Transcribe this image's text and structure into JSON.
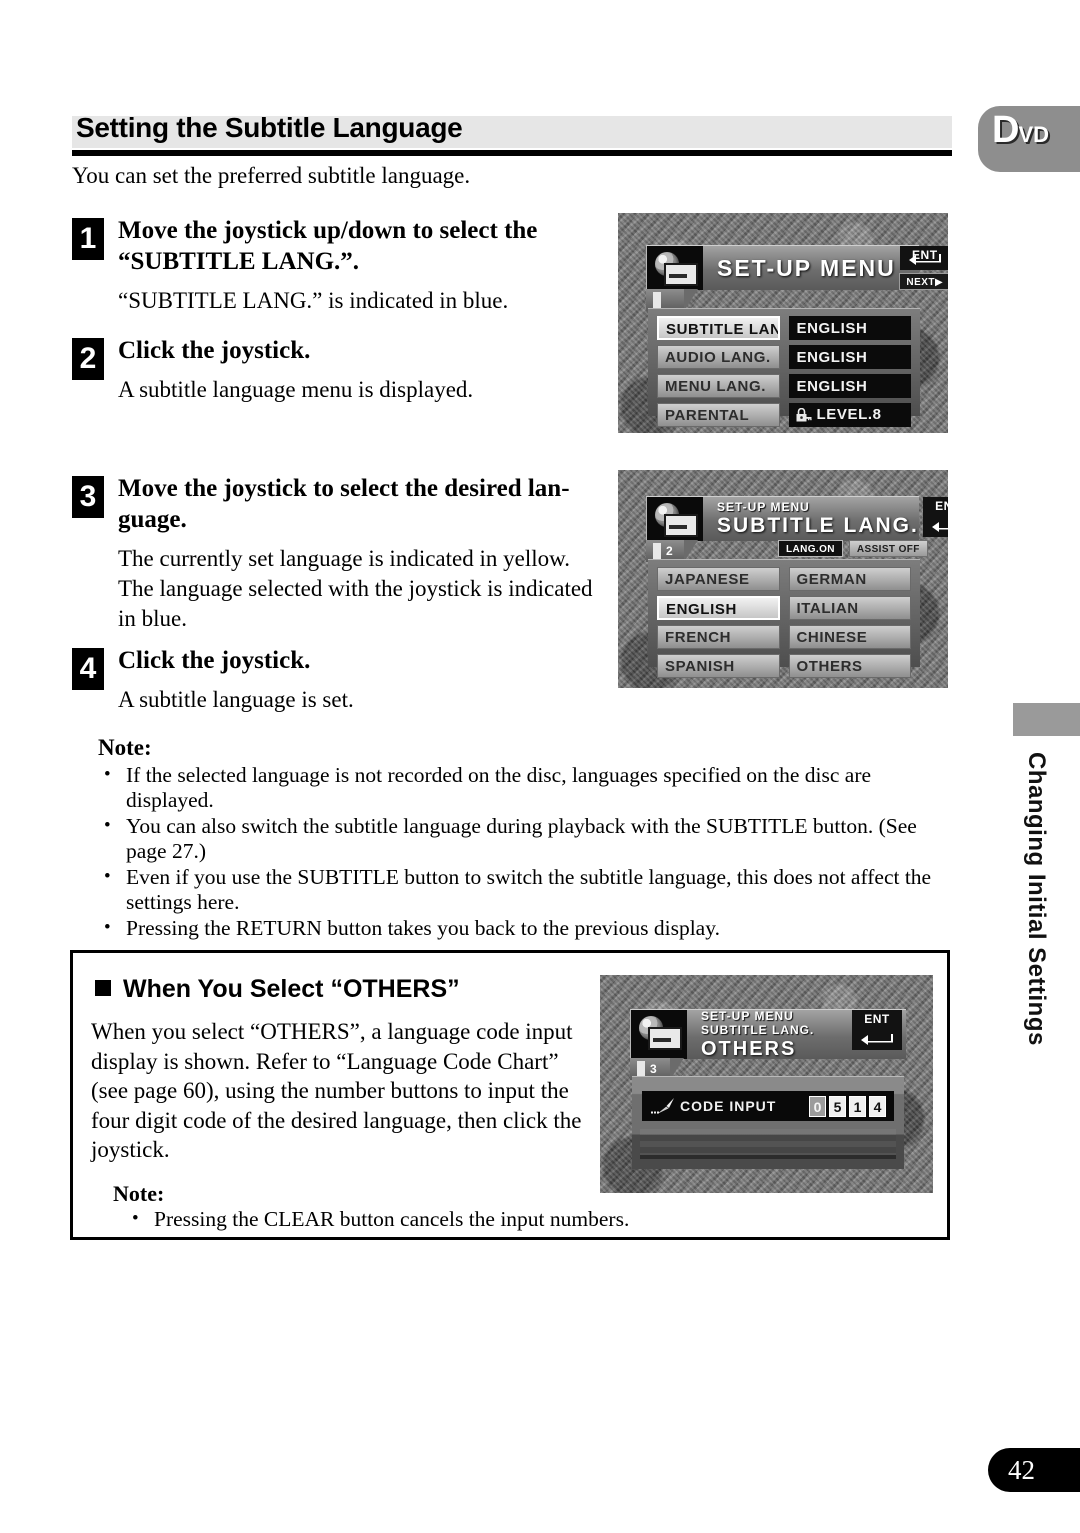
{
  "page": {
    "heading": "Setting the Subtitle Language",
    "intro": "You can set the preferred subtitle language.",
    "badge": {
      "letter": "D",
      "suffix": "VD"
    },
    "side_tab_label": "Changing Initial Settings",
    "page_number": "42"
  },
  "steps": [
    {
      "number": "1",
      "title": "Move the joystick up/down to select the “SUBTITLE LANG.”.",
      "desc": "“SUBTITLE LANG.” is indicated in blue."
    },
    {
      "number": "2",
      "title": "Click the joystick.",
      "desc": "A subtitle language menu is displayed."
    },
    {
      "number": "3",
      "title": "Move the joystick to select the desired lan-guage.",
      "desc": "The currently set language is indicated in yellow. The language selected with the joystick is indicated in blue."
    },
    {
      "number": "4",
      "title": "Click the joystick.",
      "desc": "A subtitle language is set."
    }
  ],
  "note": {
    "heading": "Note:",
    "items": [
      "If the selected language is not recorded on the disc, languages specified on the disc are displayed.",
      "You can also switch the subtitle language during playback with the SUBTITLE button. (See page 27.)",
      "Even if you use the SUBTITLE button to switch the subtitle language, this does not affect the settings here.",
      "Pressing the RETURN button takes you back to the previous display."
    ]
  },
  "others_section": {
    "heading": "When You Select “OTHERS”",
    "paragraph": "When you select “OTHERS”, a language code input display is shown. Refer to “Language Code Chart” (see page 60), using the number buttons to input the four digit code of the desired language, then click the joystick.",
    "note_heading": "Note:",
    "note_item": "Pressing the CLEAR button cancels the input numbers."
  },
  "screen1": {
    "title": "SET-UP MENU",
    "ent_label": "ENT",
    "next_label": "NEXT▶",
    "tab_number": "",
    "rows": [
      {
        "label": "SUBTITLE LANG.",
        "value": "ENGLISH",
        "label_state": "highlighted"
      },
      {
        "label": "AUDIO LANG.",
        "value": "ENGLISH",
        "label_state": "normal"
      },
      {
        "label": "MENU LANG.",
        "value": "ENGLISH",
        "label_state": "normal"
      },
      {
        "label": "PARENTAL",
        "value": "LEVEL.8",
        "label_state": "normal",
        "value_icon": "lock-icon"
      }
    ]
  },
  "screen2": {
    "title_small": "SET-UP MENU",
    "title_big": "SUBTITLE LANG.",
    "ent_label": "ENT",
    "tab_number": "2",
    "toggles": [
      {
        "label": "LANG.ON",
        "state": "on"
      },
      {
        "label": "ASSIST OFF",
        "state": "off"
      }
    ],
    "languages": [
      {
        "label": "JAPANESE",
        "state": "normal"
      },
      {
        "label": "GERMAN",
        "state": "normal"
      },
      {
        "label": "ENGLISH",
        "state": "highlighted"
      },
      {
        "label": "ITALIAN",
        "state": "normal"
      },
      {
        "label": "FRENCH",
        "state": "normal"
      },
      {
        "label": "CHINESE",
        "state": "normal"
      },
      {
        "label": "SPANISH",
        "state": "normal"
      },
      {
        "label": "OTHERS",
        "state": "normal"
      }
    ]
  },
  "screen3": {
    "title_line1": "SET-UP MENU",
    "title_line2": "SUBTITLE LANG.",
    "title_big": "OTHERS",
    "ent_label": "ENT",
    "tab_number": "3",
    "code_label": "CODE INPUT",
    "code_digits": [
      "0",
      "5",
      "1",
      "4"
    ],
    "active_digit_index": 0
  }
}
